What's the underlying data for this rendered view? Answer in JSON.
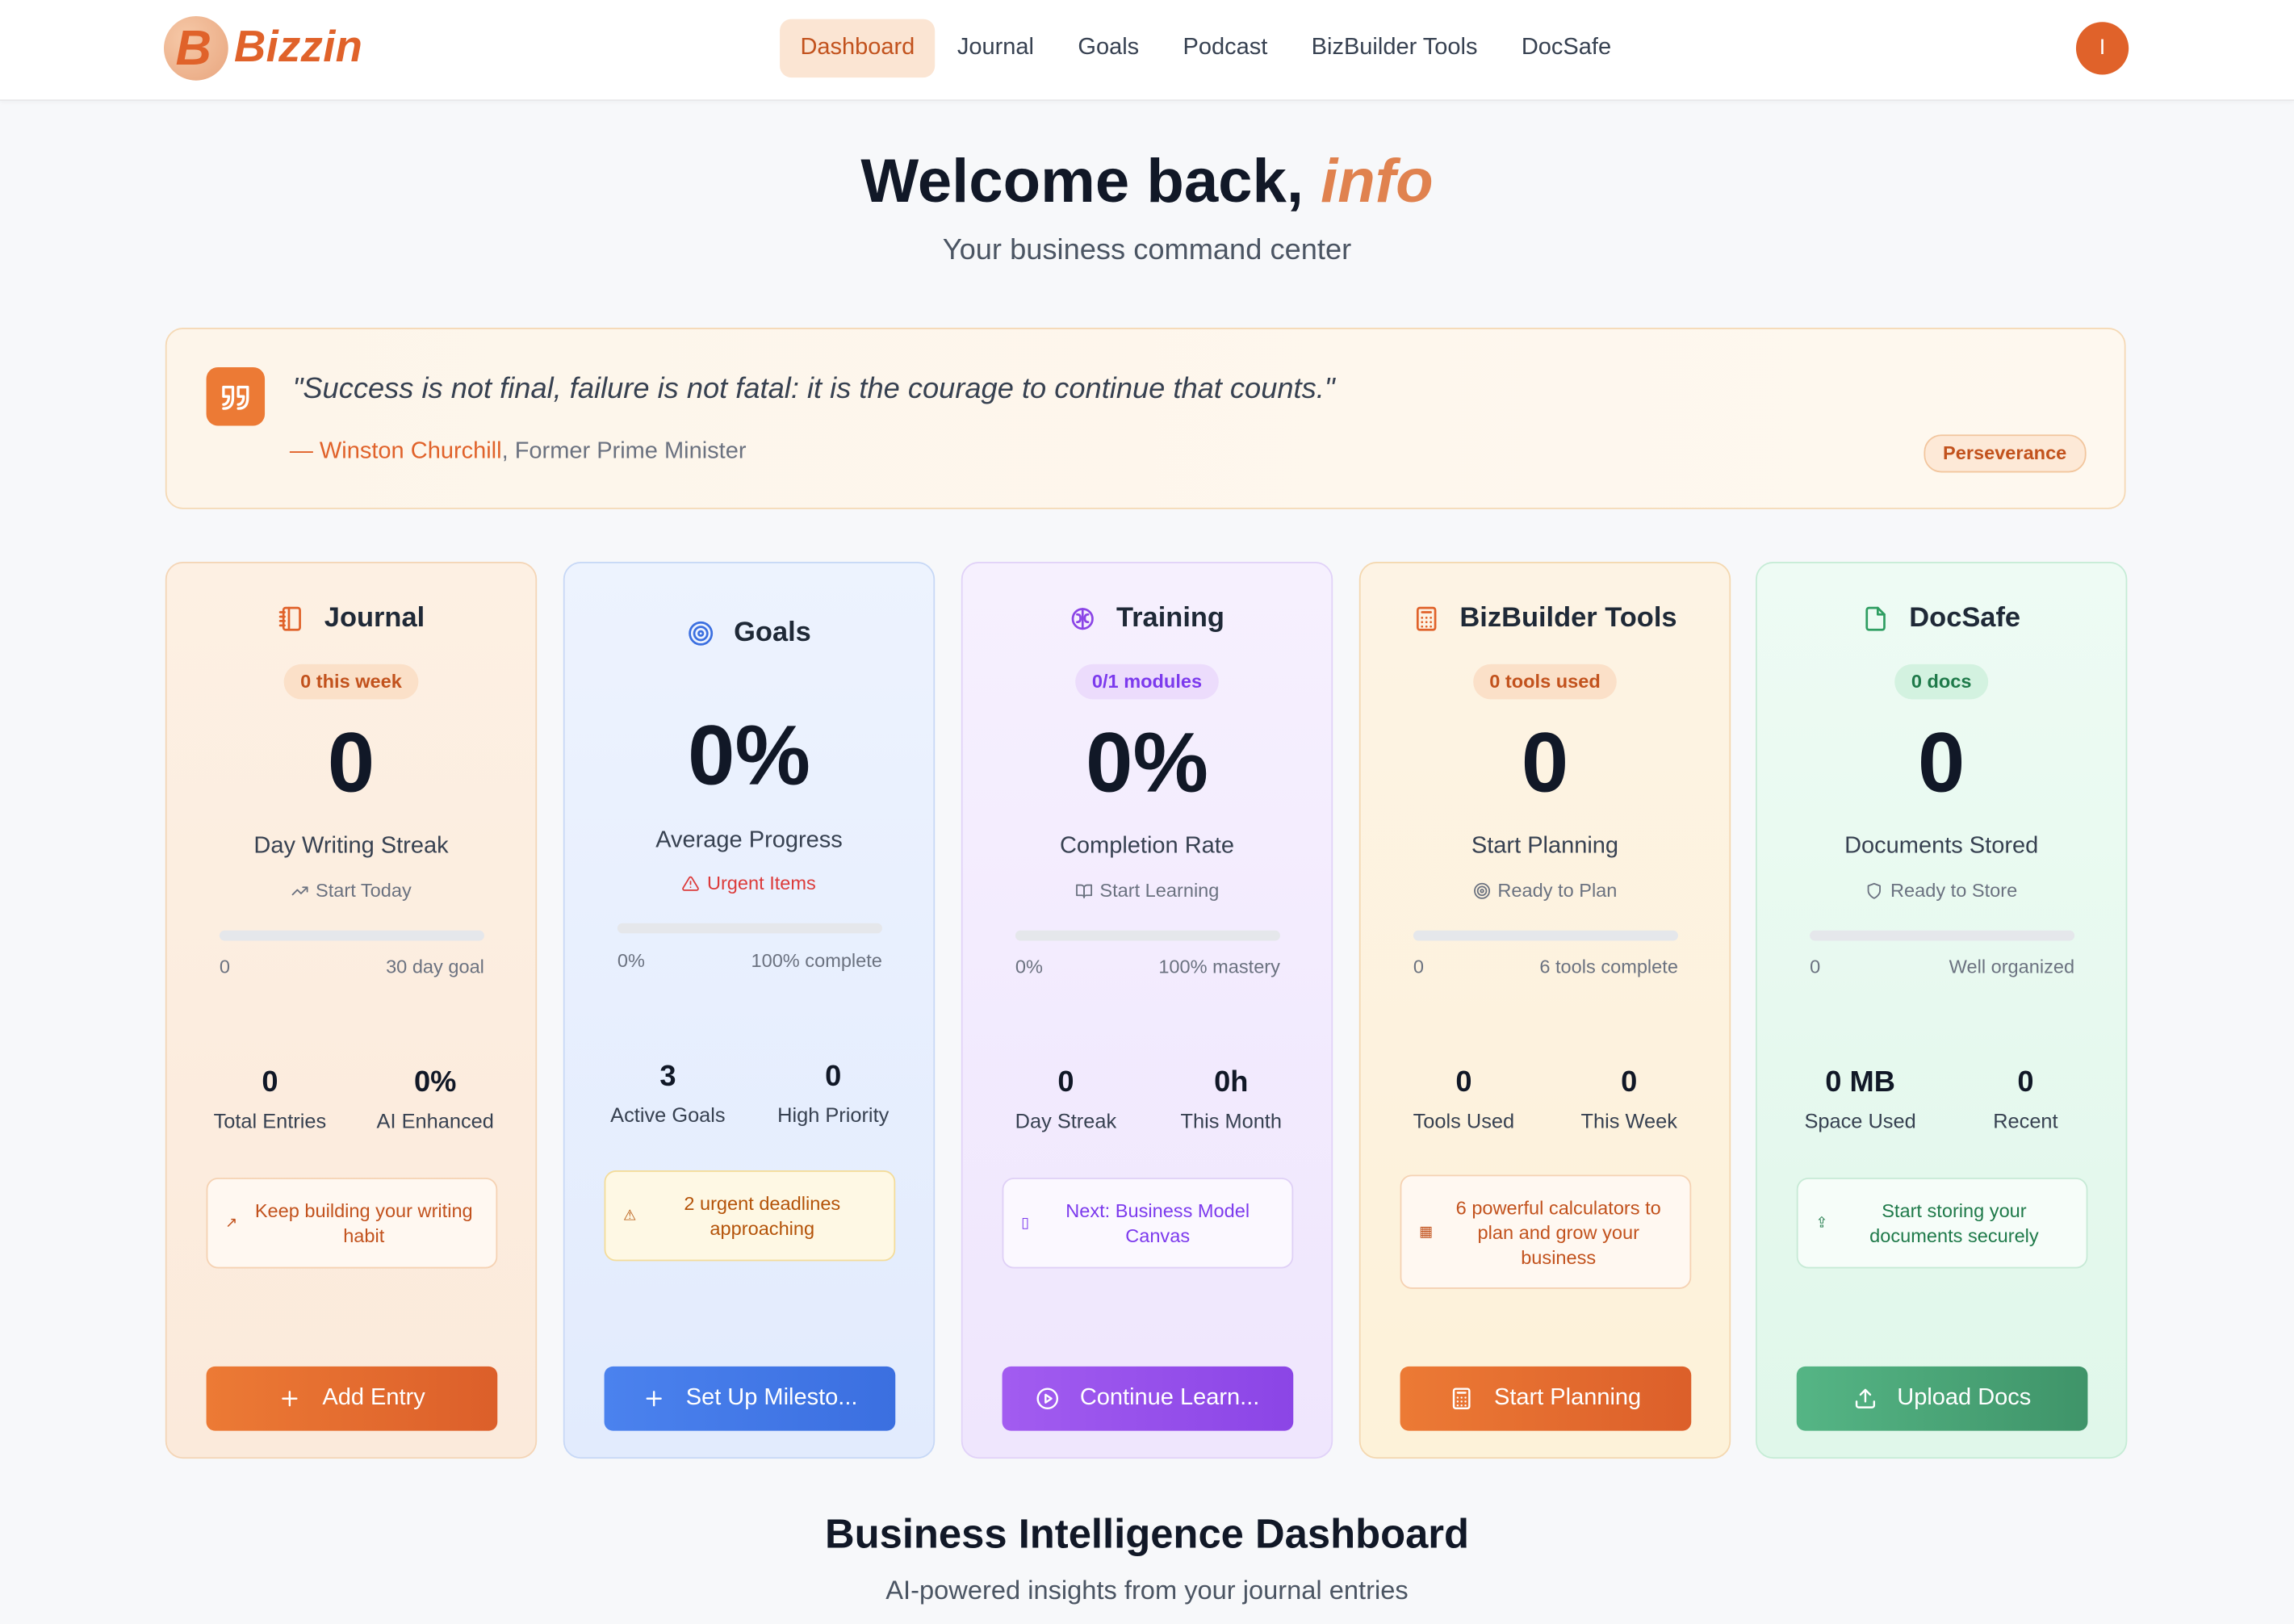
{
  "brand": {
    "logo_letter": "B",
    "name": "Bizzin",
    "accent": "#e0622a"
  },
  "nav": {
    "items": [
      "Dashboard",
      "Journal",
      "Goals",
      "Podcast",
      "BizBuilder Tools",
      "DocSafe"
    ],
    "active": "Dashboard"
  },
  "user": {
    "initial": "I"
  },
  "hero": {
    "title_prefix": "Welcome back, ",
    "title_name": "info",
    "subtitle": "Your business command center"
  },
  "quote": {
    "text": "\"Success is not final, failure is not fatal: it is the courage to continue that counts.\"",
    "author": "— Winston Churchill",
    "author_role": ", Former Prime Minister",
    "tag": "Perseverance"
  },
  "cards": {
    "journal": {
      "title": "Journal",
      "icon": "notebook-icon",
      "badge": "0 this week",
      "value": "0",
      "label": "Day Writing Streak",
      "sub": "Start Today",
      "progress": 0,
      "range_start": "0",
      "range_end": "30 day goal",
      "stat1_value": "0",
      "stat1_label": "Total Entries",
      "stat2_value": "0%",
      "stat2_label": "AI Enhanced",
      "notice": "Keep building your writing habit",
      "button": "Add Entry"
    },
    "goals": {
      "title": "Goals",
      "icon": "target-icon",
      "value": "0%",
      "label": "Average Progress",
      "sub": "Urgent Items",
      "progress": 0,
      "range_start": "0%",
      "range_end": "100% complete",
      "stat1_value": "3",
      "stat1_label": "Active Goals",
      "stat2_value": "0",
      "stat2_label": "High Priority",
      "notice": "2 urgent deadlines approaching",
      "button": "Set Up Milesto..."
    },
    "training": {
      "title": "Training",
      "icon": "brain-icon",
      "badge": "0/1 modules",
      "value": "0%",
      "label": "Completion Rate",
      "sub": "Start Learning",
      "progress": 0,
      "range_start": "0%",
      "range_end": "100% mastery",
      "stat1_value": "0",
      "stat1_label": "Day Streak",
      "stat2_value": "0h",
      "stat2_label": "This Month",
      "notice": "Next: Business Model Canvas",
      "button": "Continue Learn..."
    },
    "biz": {
      "title": "BizBuilder Tools",
      "icon": "calculator-icon",
      "badge": "0 tools used",
      "value": "0",
      "label": "Start Planning",
      "sub": "Ready to Plan",
      "progress": 0,
      "range_start": "0",
      "range_end": "6 tools complete",
      "stat1_value": "0",
      "stat1_label": "Tools Used",
      "stat2_value": "0",
      "stat2_label": "This Week",
      "notice": "6 powerful calculators to plan and grow your business",
      "button": "Start Planning"
    },
    "doc": {
      "title": "DocSafe",
      "icon": "document-icon",
      "badge": "0 docs",
      "value": "0",
      "label": "Documents Stored",
      "sub": "Ready to Store",
      "progress": 0,
      "range_start": "0",
      "range_end": "Well organized",
      "stat1_value": "0 MB",
      "stat1_label": "Space Used",
      "stat2_value": "0",
      "stat2_label": "Recent",
      "notice": "Start storing your documents securely",
      "button": "Upload Docs"
    }
  },
  "section": {
    "title": "Business Intelligence Dashboard",
    "subtitle": "AI-powered insights from your journal entries"
  }
}
